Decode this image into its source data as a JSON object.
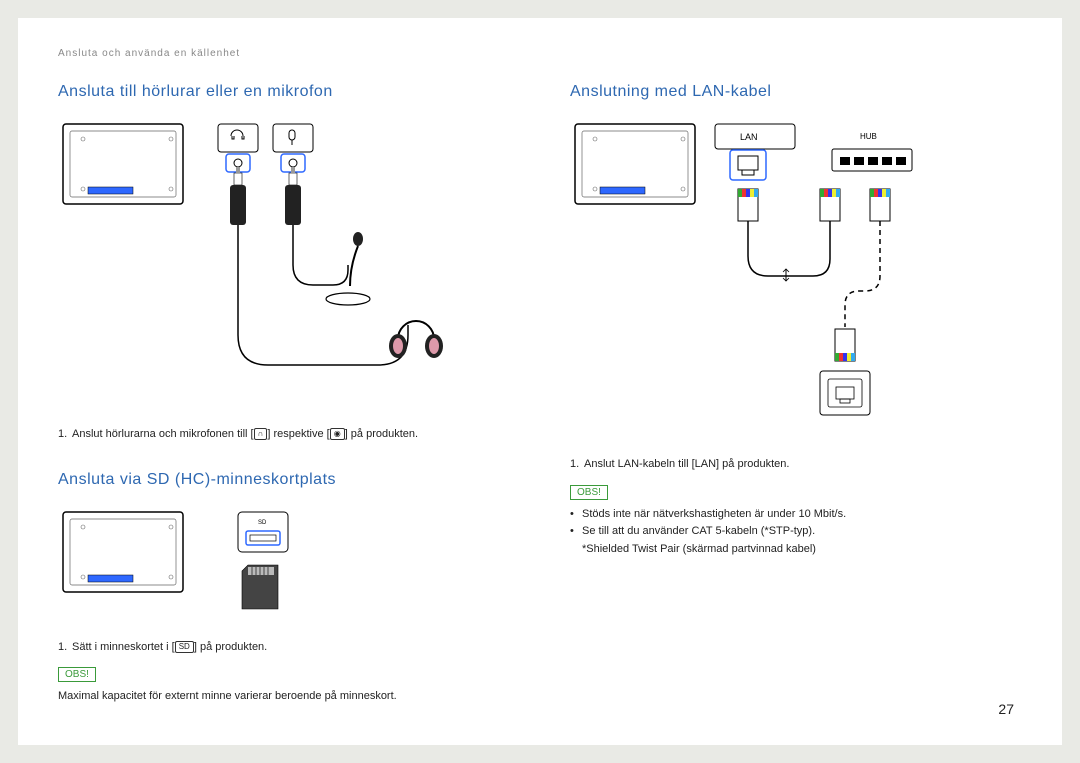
{
  "breadcrumb": "Ansluta och använda en källenhet",
  "page_number": "27",
  "sections": {
    "headphones": {
      "heading": "Ansluta till hörlurar eller en mikrofon",
      "step_num": "1.",
      "step_a": "Anslut hörlurarna och mikrofonen till [",
      "step_b": "] respektive [",
      "step_c": "] på produkten."
    },
    "sd": {
      "heading": "Ansluta via SD (HC)-minneskortplats",
      "step_num": "1.",
      "step_a": "Sätt i minneskortet i [",
      "step_b": "] på produkten.",
      "obs_label": "OBS!",
      "note": "Maximal kapacitet för externt minne varierar beroende på minneskort."
    },
    "lan": {
      "heading": "Anslutning med LAN-kabel",
      "step_num": "1.",
      "step": "Anslut LAN-kabeln till [LAN] på produkten.",
      "obs_label": "OBS!",
      "bullet1": "Stöds inte när nätverkshastigheten är under 10 Mbit/s.",
      "bullet2": "Se till att du använder CAT 5-kabeln (*STP-typ).",
      "bullet2_sub": "*Shielded Twist Pair (skärmad partvinnad kabel)"
    }
  },
  "icons": {
    "headphone": "♫",
    "mic": "●",
    "sd": "SD",
    "lan_label": "LAN",
    "hub_label": "HUB"
  }
}
